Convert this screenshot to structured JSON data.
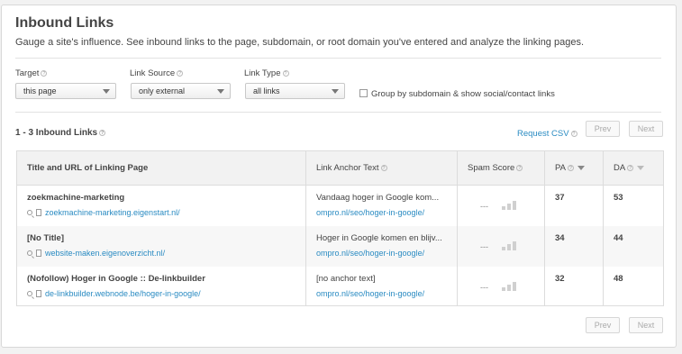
{
  "header": {
    "title": "Inbound Links",
    "subtitle": "Gauge a site's influence. See inbound links to the page, subdomain, or root domain you've entered and analyze the linking pages."
  },
  "filters": {
    "target": {
      "label": "Target",
      "value": "this page"
    },
    "link_source": {
      "label": "Link Source",
      "value": "only external"
    },
    "link_type": {
      "label": "Link Type",
      "value": "all links"
    },
    "group_checkbox": {
      "label": "Group by subdomain & show social/contact links",
      "checked": false
    }
  },
  "results": {
    "count_label": "1 - 3 Inbound Links",
    "request_csv": "Request CSV",
    "prev_label": "Prev",
    "next_label": "Next"
  },
  "table": {
    "headers": {
      "title_url": "Title and URL of Linking Page",
      "anchor": "Link Anchor Text",
      "spam": "Spam Score",
      "pa": "PA",
      "da": "DA"
    },
    "rows": [
      {
        "title": "zoekmachine-marketing",
        "url": "zoekmachine-marketing.eigenstart.nl/",
        "anchor": "Vandaag hoger in Google kom...",
        "target": "ompro.nl/seo/hoger-in-google/",
        "spam": "---",
        "pa": "37",
        "da": "53"
      },
      {
        "title": "[No Title]",
        "url": "website-maken.eigenoverzicht.nl/",
        "anchor": "Hoger in Google komen en blijv...",
        "target": "ompro.nl/seo/hoger-in-google/",
        "spam": "---",
        "pa": "34",
        "da": "44"
      },
      {
        "title": "(Nofollow) Hoger in Google :: De-linkbuilder",
        "url": "de-linkbuilder.webnode.be/hoger-in-google/",
        "anchor": "[no anchor text]",
        "target": "ompro.nl/seo/hoger-in-google/",
        "spam": "---",
        "pa": "32",
        "da": "48"
      }
    ]
  },
  "colors": {
    "link": "#2a8bc2",
    "header_bg": "#f2f2f2",
    "alt_row_bg": "#f7f7f7"
  },
  "icons": [
    "help-icon",
    "dropdown-caret-icon",
    "magnifier-icon",
    "page-copy-icon",
    "spam-bars-icon",
    "sort-arrow-icon"
  ]
}
